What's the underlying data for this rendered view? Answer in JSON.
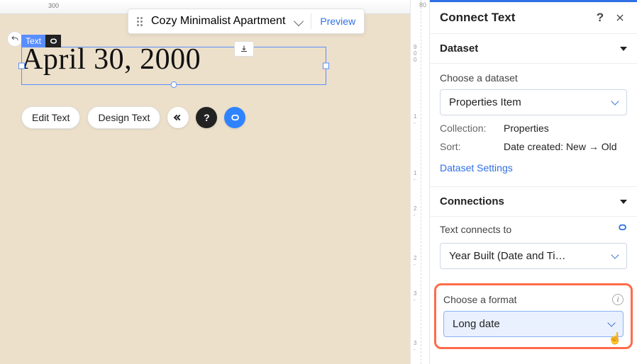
{
  "topbar": {
    "title": "Cozy Minimalist Apartment",
    "preview": "Preview"
  },
  "element": {
    "tag_label": "Text",
    "display_text": "April 30, 2000"
  },
  "toolbar": {
    "edit": "Edit Text",
    "design": "Design Text"
  },
  "panel": {
    "title": "Connect Text",
    "dataset": {
      "heading": "Dataset",
      "choose_label": "Choose a dataset",
      "selected": "Properties Item",
      "collection_label": "Collection:",
      "collection_value": "Properties",
      "sort_label": "Sort:",
      "sort_value": "Date created: New → Old",
      "settings_link": "Dataset Settings"
    },
    "connections": {
      "heading": "Connections",
      "connects_label": "Text connects to",
      "selected": "Year Built (Date and Ti…",
      "format_label": "Choose a format",
      "format_value": "Long date"
    }
  },
  "ruler": {
    "right_top": "80"
  }
}
